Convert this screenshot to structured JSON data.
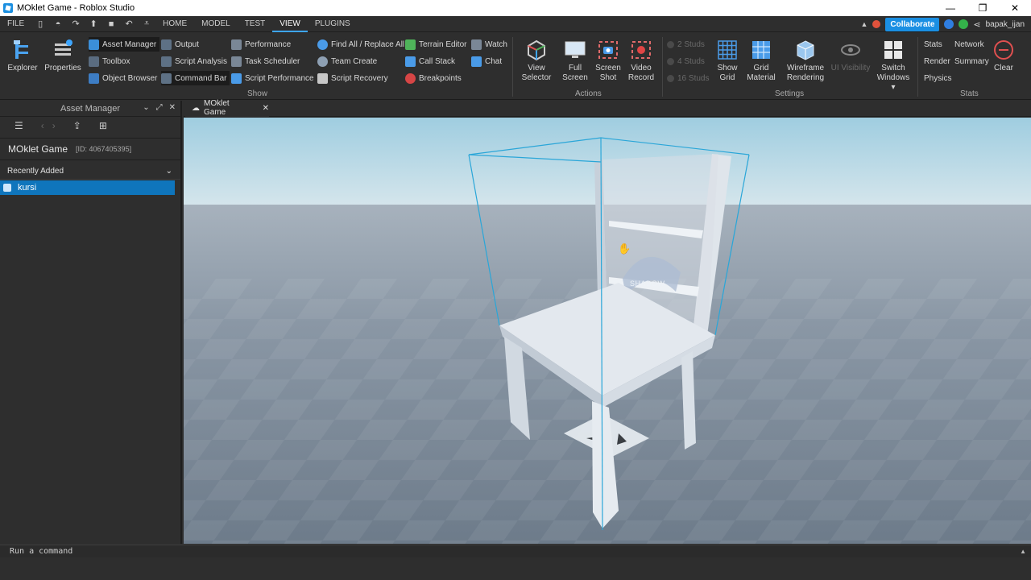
{
  "window": {
    "title": "MOklet Game - Roblox Studio",
    "minimize": "—",
    "restore": "❐",
    "close": "✕"
  },
  "menu": {
    "items": [
      "FILE",
      "HOME",
      "MODEL",
      "TEST",
      "VIEW",
      "PLUGINS"
    ],
    "active": "VIEW"
  },
  "toolbar_right": {
    "collaborate": "Collaborate",
    "username": "bapak_ijan"
  },
  "ribbon": {
    "explorer": "Explorer",
    "properties": "Properties",
    "show_items": {
      "asset_manager": "Asset Manager",
      "toolbox": "Toolbox",
      "object_browser": "Object Browser",
      "output": "Output",
      "script_analysis": "Script Analysis",
      "command_bar": "Command Bar",
      "performance": "Performance",
      "task_scheduler": "Task Scheduler",
      "script_performance": "Script Performance",
      "find_all": "Find All / Replace All",
      "team_create": "Team Create",
      "script_recovery": "Script Recovery",
      "terrain_editor": "Terrain Editor",
      "call_stack": "Call Stack",
      "breakpoints": "Breakpoints",
      "watch": "Watch",
      "chat": "Chat"
    },
    "show_label": "Show",
    "actions": {
      "view_selector": [
        "View",
        "Selector"
      ],
      "full_screen": [
        "Full",
        "Screen"
      ],
      "screen_shot": [
        "Screen",
        "Shot"
      ],
      "video_record": [
        "Video",
        "Record"
      ],
      "label": "Actions"
    },
    "settings": {
      "studs": [
        "2 Studs",
        "4 Studs",
        "16 Studs"
      ],
      "show_grid": [
        "Show",
        "Grid"
      ],
      "grid_material": [
        "Grid",
        "Material"
      ],
      "wireframe": [
        "Wireframe",
        "Rendering"
      ],
      "ui_visibility": "UI Visibility",
      "switch_windows": [
        "Switch",
        "Windows ▾"
      ],
      "label": "Settings"
    },
    "stats": {
      "stats": "Stats",
      "network": "Network",
      "render": "Render",
      "summary": "Summary",
      "physics": "Physics",
      "clear": "Clear",
      "label": "Stats"
    }
  },
  "asset_manager": {
    "title": "Asset Manager",
    "game_name": "MOklet Game",
    "game_id": "[ID: 4067405395]",
    "section": "Recently Added",
    "items": [
      "kursi"
    ]
  },
  "tabs": [
    {
      "label": "MOklet Game"
    }
  ],
  "viewport": {
    "shadow_label": "SHADOW"
  },
  "command_bar": {
    "placeholder": "Run a command"
  },
  "colors": {
    "accent": "#1a8fe3",
    "selection": "#0f75bc",
    "panel": "#2e2e2e",
    "sky_top": "#98c8df",
    "baseplate": "#7d8a99"
  }
}
